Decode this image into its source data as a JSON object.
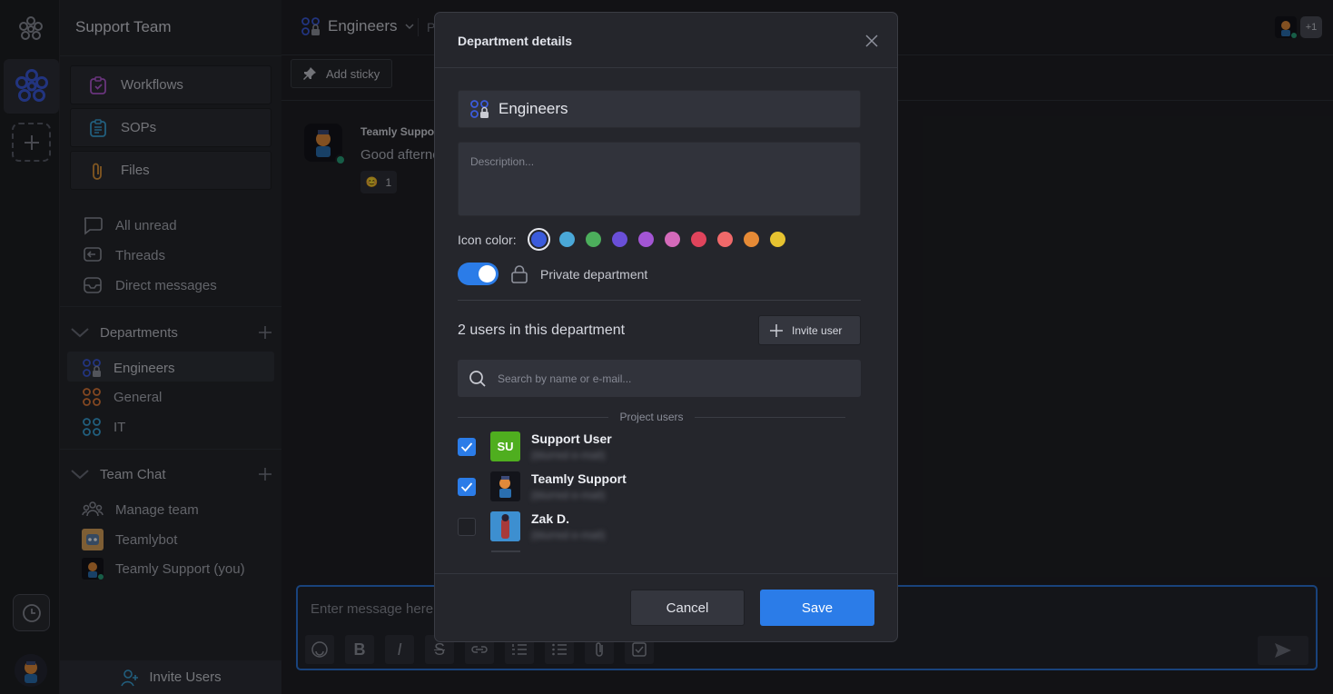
{
  "sidebar": {
    "workspace_title": "Support Team",
    "tools": [
      {
        "label": "Workflows",
        "icon": "workflow-icon"
      },
      {
        "label": "SOPs",
        "icon": "sop-icon"
      },
      {
        "label": "Files",
        "icon": "paperclip-icon"
      }
    ],
    "nav": [
      {
        "label": "All unread",
        "icon": "chat-bubble-icon"
      },
      {
        "label": "Threads",
        "icon": "threads-icon"
      },
      {
        "label": "Direct messages",
        "icon": "inbox-icon"
      }
    ],
    "departments_label": "Departments",
    "departments": [
      {
        "label": "Engineers",
        "color": "#3b5bdb"
      },
      {
        "label": "General",
        "color": "#e07a3a"
      },
      {
        "label": "IT",
        "color": "#3aa2d8"
      }
    ],
    "team_chat_label": "Team Chat",
    "team_chat": [
      {
        "label": "Manage team",
        "icon": "team-icon"
      },
      {
        "label": "Teamlybot",
        "icon": "bot-avatar"
      },
      {
        "label": "Teamly Support (you)",
        "icon": "user-avatar"
      }
    ],
    "invite_users": "Invite Users"
  },
  "main": {
    "channel_title": "Engineers",
    "topbar_partial": "P",
    "more_users": "+1",
    "add_sticky": "Add sticky",
    "message": {
      "author": "Teamly Suppor",
      "text": "Good afterno",
      "reaction_count": "1"
    },
    "composer_placeholder": "Enter message here..."
  },
  "modal": {
    "title": "Department details",
    "name_value": "Engineers",
    "description_placeholder": "Description...",
    "icon_color_label": "Icon color:",
    "colors": [
      "#3b5bdb",
      "#4aa8d8",
      "#4cae5c",
      "#6a4fd8",
      "#a355d4",
      "#d46aba",
      "#e0445c",
      "#f0696a",
      "#e68a36",
      "#e6c230"
    ],
    "selected_color": "#3b5bdb",
    "private_label": "Private department",
    "private_enabled": true,
    "users_count": "2 users in this department",
    "invite_user": "Invite user",
    "search_placeholder": "Search by name or e-mail...",
    "project_users_label": "Project users",
    "users": [
      {
        "name": "Support User",
        "initials": "SU",
        "email": "(blurred e-mail)",
        "checked": true,
        "avatar_color": "#4fae1f"
      },
      {
        "name": "Teamly Support",
        "initials": "",
        "email": "(blurred e-mail)",
        "checked": true,
        "avatar_color": "#13141a"
      },
      {
        "name": "Zak D.",
        "initials": "",
        "email": "(blurred e-mail)",
        "checked": false,
        "avatar_color": "#2a6fb0"
      }
    ],
    "cancel": "Cancel",
    "save": "Save"
  },
  "colors": {
    "accent": "#2b7ce8",
    "background": "#1f2025",
    "modal_bg": "#25262c"
  }
}
